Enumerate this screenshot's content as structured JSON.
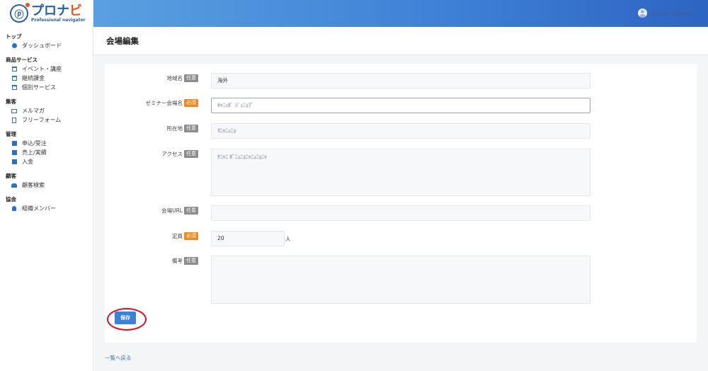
{
  "app": {
    "logo_main": "プロナビ",
    "logo_main_accent": "ビ",
    "logo_sub": "Professional navigator"
  },
  "topbar": {
    "user_name": "ﾆｬﾆｭﾆｮﾆｬﾆｭﾆｮﾆｬﾆｭ"
  },
  "sidebar": {
    "sections": [
      {
        "heading": "トップ",
        "items": [
          {
            "label": "ダッシュボード",
            "icon": "dashboard-icon"
          }
        ]
      },
      {
        "heading": "商品サービス",
        "items": [
          {
            "label": "イベント・講座",
            "icon": "calendar-icon"
          },
          {
            "label": "継続課金",
            "icon": "calendar-icon"
          },
          {
            "label": "個別サービス",
            "icon": "calendar-icon"
          }
        ]
      },
      {
        "heading": "集客",
        "items": [
          {
            "label": "メルマガ",
            "icon": "mail-icon"
          },
          {
            "label": "フリーフォーム",
            "icon": "document-icon"
          }
        ]
      },
      {
        "heading": "管理",
        "items": [
          {
            "label": "申込/受注",
            "icon": "square-icon"
          },
          {
            "label": "売上/実績",
            "icon": "square-icon"
          },
          {
            "label": "入金",
            "icon": "square-icon"
          }
        ]
      },
      {
        "heading": "顧客",
        "items": [
          {
            "label": "顧客検索",
            "icon": "users-icon"
          }
        ]
      },
      {
        "heading": "協会",
        "items": [
          {
            "label": "組織メンバー",
            "icon": "user-icon"
          }
        ]
      }
    ]
  },
  "page": {
    "title": "会場編集"
  },
  "badges": {
    "optional": "任意",
    "required": "必須"
  },
  "form": {
    "region": {
      "label": "地域名",
      "value": "海外"
    },
    "venue_name": {
      "label": "ゼミナー会場名",
      "value": "ｷｬﾆｭﾎﾞ ｼﾞｭﾆｮﾌﾞ"
    },
    "address": {
      "label": "所在地",
      "value": "ﾏﾆｬﾆｭﾆｮ"
    },
    "access": {
      "label": "アクセス",
      "value": "ﾅﾆｬﾆ ﾎﾞﾆｭﾆｮﾆｬﾆｭﾆｮﾆｬ"
    },
    "venue_url": {
      "label": "会場URL",
      "value": ""
    },
    "capacity": {
      "label": "定員",
      "value": "20",
      "unit": "人"
    },
    "notes": {
      "label": "備考",
      "value": ""
    },
    "save_label": "保存"
  },
  "footer": {
    "back_link": "一覧へ戻る"
  },
  "colors": {
    "accent": "#3b82d6",
    "required_badge": "#f08a1e",
    "optional_badge": "#8c8c8c",
    "highlight": "#d8101a"
  }
}
